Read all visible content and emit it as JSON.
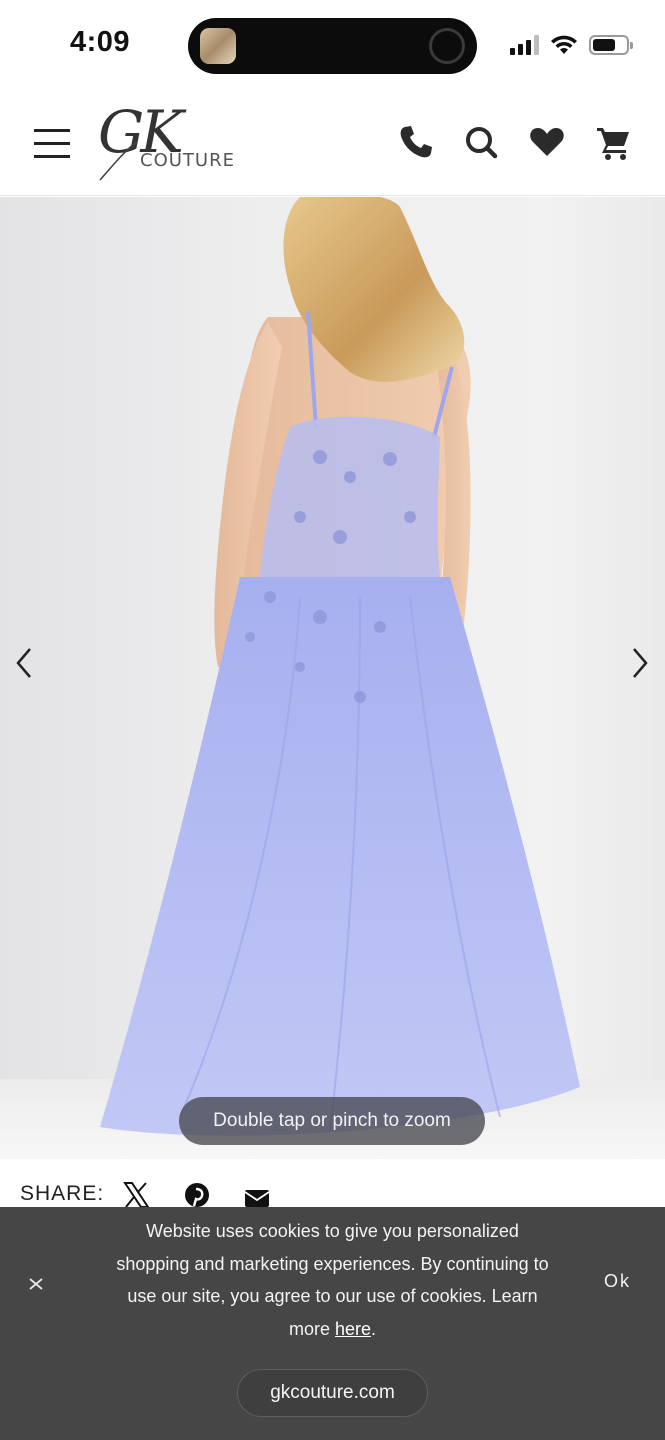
{
  "status_bar": {
    "time": "4:09",
    "battery_level": 0.7,
    "signal_bars": 3
  },
  "header": {
    "logo_script": "GK",
    "logo_subtitle": "COUTURE",
    "icons": [
      "menu-icon",
      "phone-icon",
      "search-icon",
      "heart-icon",
      "cart-icon"
    ]
  },
  "gallery": {
    "zoom_hint": "Double tap or pinch to zoom",
    "dress_color": "#a9b3f2"
  },
  "share": {
    "label": "SHARE:",
    "icons": [
      "x-icon",
      "pinterest-icon",
      "email-icon"
    ]
  },
  "cookie": {
    "text": "Website uses cookies to give you personalized shopping and marketing experiences. By continuing to use our site, you agree to our use of cookies. Learn more ",
    "link_text": "here",
    "suffix": ".",
    "ok_label": "Ok",
    "url": "gkcouture.com"
  },
  "colors": {
    "banner_bg": "#464646",
    "accent_dress": "#a9b3f2"
  }
}
